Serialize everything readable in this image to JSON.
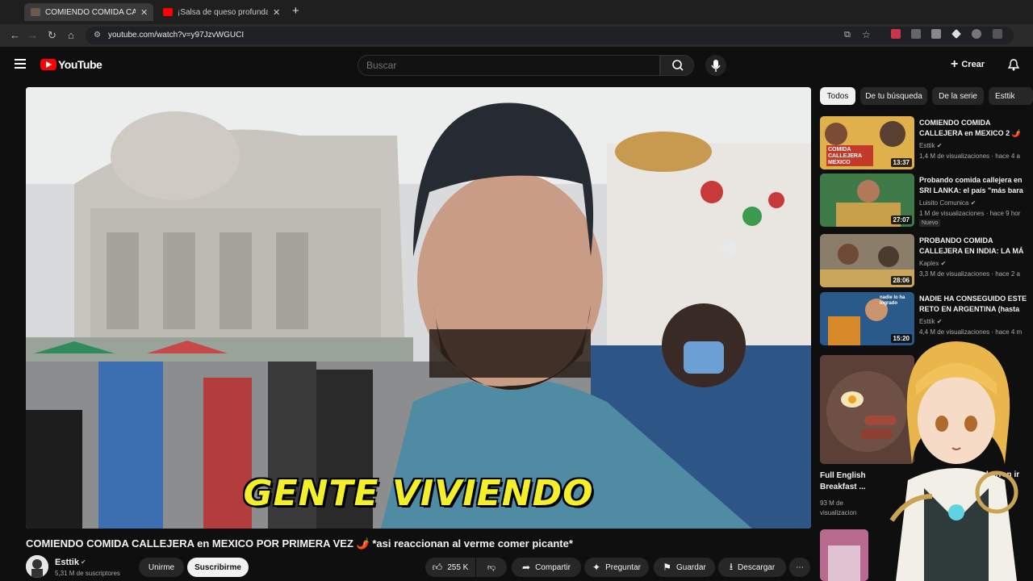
{
  "browser": {
    "tabs": [
      {
        "label": "COMIENDO COMIDA CALLEJERA",
        "close": "✕"
      },
      {
        "label": "¡Salsa de queso profunda casera",
        "close": "✕"
      }
    ],
    "new_tab": "+",
    "url": "youtube.com/watch?v=y97JzvWGUCI"
  },
  "header": {
    "logo_text": "YouTube",
    "search_placeholder": "Buscar",
    "create_label": "Crear"
  },
  "video": {
    "caption": "GENTE VIVIENDO",
    "title": "COMIENDO COMIDA CALLEJERA en MEXICO POR PRIMERA VEZ 🌶️ *asi reaccionan al verme comer picante*",
    "channel": "Esttik",
    "subscribers": "5,31 M de suscriptores",
    "join_label": "Unirme",
    "subscribe_label": "Suscribirme",
    "likes": "255 K",
    "share_label": "Compartir",
    "ask_label": "Preguntar",
    "save_label": "Guardar",
    "download_label": "Descargar",
    "more_label": "⋯"
  },
  "sidebar": {
    "chips": [
      "Todos",
      "De tu búsqueda",
      "De la serie",
      "Esttik"
    ],
    "items": [
      {
        "title": "COMIENDO COMIDA CALLEJERA en MEXICO 2 🌶️",
        "channel": "Esttik ✔",
        "meta": "1,4 M de visualizaciones · hace 4 a",
        "duration": "13:37",
        "thumb_text": "COMIDA CALLEJERA MEXICO"
      },
      {
        "title": "Probando comida callejera en SRI LANKA: el país \"más bara",
        "channel": "Luisito Comunica ✔",
        "meta": "1 M de visualizaciones · hace 9 hor",
        "duration": "27:07",
        "badge": "Nuevo"
      },
      {
        "title": "PROBANDO COMIDA CALLEJERA EN INDIA: LA MÁ",
        "channel": "Kaplex ✔",
        "meta": "3,3 M de visualizaciones · hace 2 a",
        "duration": "28:06"
      },
      {
        "title": "NADIE HA CONSEGUIDO ESTE RETO EN ARGENTINA (hasta",
        "channel": "Esttik ✔",
        "meta": "4,4 M de visualizaciones · hace 4 m",
        "duration": "15:20",
        "thumb_text": "nadie lo ha logrado"
      }
    ],
    "big_item": {
      "title": "Full English Breakfast ...",
      "meta_line1": "93 M de",
      "meta_line2": "visualizacion",
      "right_text": "barron ir"
    }
  },
  "colors": {
    "accent": "#ff0000",
    "background": "#0f0f0f",
    "caption": "#f3ef2a"
  }
}
